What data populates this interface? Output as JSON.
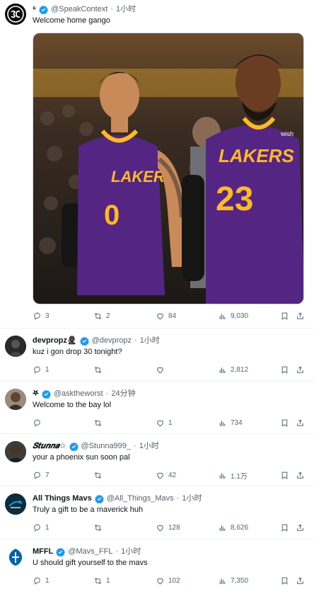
{
  "posts": [
    {
      "name": "⁶",
      "handle": "@SpeakContext",
      "time": "1小时",
      "text": "Welcome home gango",
      "stats": {
        "replies": "3",
        "retweets": "2",
        "likes": "84",
        "views": "9,030"
      },
      "media": {
        "jersey_left": "LAKERS",
        "number_left": "0",
        "jersey_right": "LAKERS",
        "number_right": "23",
        "sponsor": "wish"
      }
    },
    {
      "name": "devpropz🥷🏿",
      "handle": "@devpropz",
      "time": "1小时",
      "text": "kuz i gon drop 30 tonight?",
      "stats": {
        "replies": "1",
        "retweets": "",
        "likes": "",
        "views": "2,812"
      }
    },
    {
      "name": "⛧",
      "handle": "@asktheworst",
      "time": "24分钟",
      "text": "Welcome to the bay lol",
      "stats": {
        "replies": "",
        "retweets": "",
        "likes": "1",
        "views": "734"
      }
    },
    {
      "name": "𝑺𝒕𝒖𝒏𝒏𝒂☆",
      "handle": "@Stunna999_",
      "time": "1小时",
      "text": "your a phoenix sun soon pal",
      "stats": {
        "replies": "7",
        "retweets": "",
        "likes": "42",
        "views": "1.1万"
      }
    },
    {
      "name": "All Things Mavs",
      "handle": "@All_Things_Mavs",
      "time": "1小时",
      "text": "Truly a gift to be a maverick huh",
      "stats": {
        "replies": "1",
        "retweets": "",
        "likes": "128",
        "views": "8,626"
      }
    },
    {
      "name": "MFFL",
      "handle": "@Mavs_FFL",
      "time": "1小时",
      "text": "U should gift yourself to the mavs",
      "stats": {
        "replies": "1",
        "retweets": "1",
        "likes": "102",
        "views": "7,350"
      }
    }
  ],
  "colors": {
    "verified": "#1d9bf0",
    "muted": "#536471",
    "text": "#0f1419",
    "lakers_purple": "#552583",
    "lakers_gold": "#fdb927"
  },
  "icons": {
    "reply": "reply-icon",
    "retweet": "retweet-icon",
    "like": "heart-icon",
    "views": "views-icon",
    "bookmark": "bookmark-icon",
    "share": "share-icon"
  }
}
